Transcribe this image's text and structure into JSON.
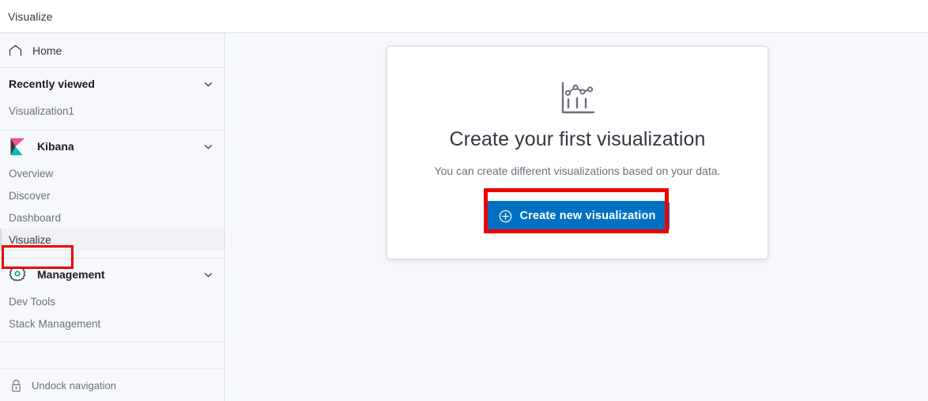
{
  "topbar": {
    "title": "Visualize"
  },
  "sidebar": {
    "home": {
      "label": "Home",
      "icon": "home-icon"
    },
    "recently_viewed": {
      "title": "Recently viewed",
      "chevron": "chevron-down-icon",
      "items": [
        {
          "label": "Visualization1"
        }
      ]
    },
    "kibana": {
      "title": "Kibana",
      "logo": "kibana-logo-icon",
      "chevron": "chevron-down-icon",
      "items": [
        {
          "label": "Overview",
          "selected": false
        },
        {
          "label": "Discover",
          "selected": false
        },
        {
          "label": "Dashboard",
          "selected": false
        },
        {
          "label": "Visualize",
          "selected": true
        }
      ]
    },
    "management": {
      "title": "Management",
      "logo": "gear-icon",
      "chevron": "chevron-down-icon",
      "items": [
        {
          "label": "Dev Tools",
          "selected": false
        },
        {
          "label": "Stack Management",
          "selected": false
        }
      ]
    },
    "footer": {
      "label": "Undock navigation",
      "icon": "lock-icon"
    }
  },
  "main": {
    "card": {
      "icon": "visualization-chart-icon",
      "title": "Create your first visualization",
      "subtitle": "You can create different visualizations based on your data.",
      "button": {
        "label": "Create new visualization",
        "icon": "plus-in-circle-icon"
      }
    }
  },
  "annotations": {
    "sidebar_highlight": "red-highlight-box",
    "button_highlight": "red-highlight-box"
  },
  "colors": {
    "accent_blue": "#0071c2",
    "highlight_red": "#ee0000",
    "kibana_pink": "#f04e98",
    "kibana_teal": "#00bfb3",
    "page_bg": "#f7f8fc",
    "border": "#d3dae6"
  }
}
